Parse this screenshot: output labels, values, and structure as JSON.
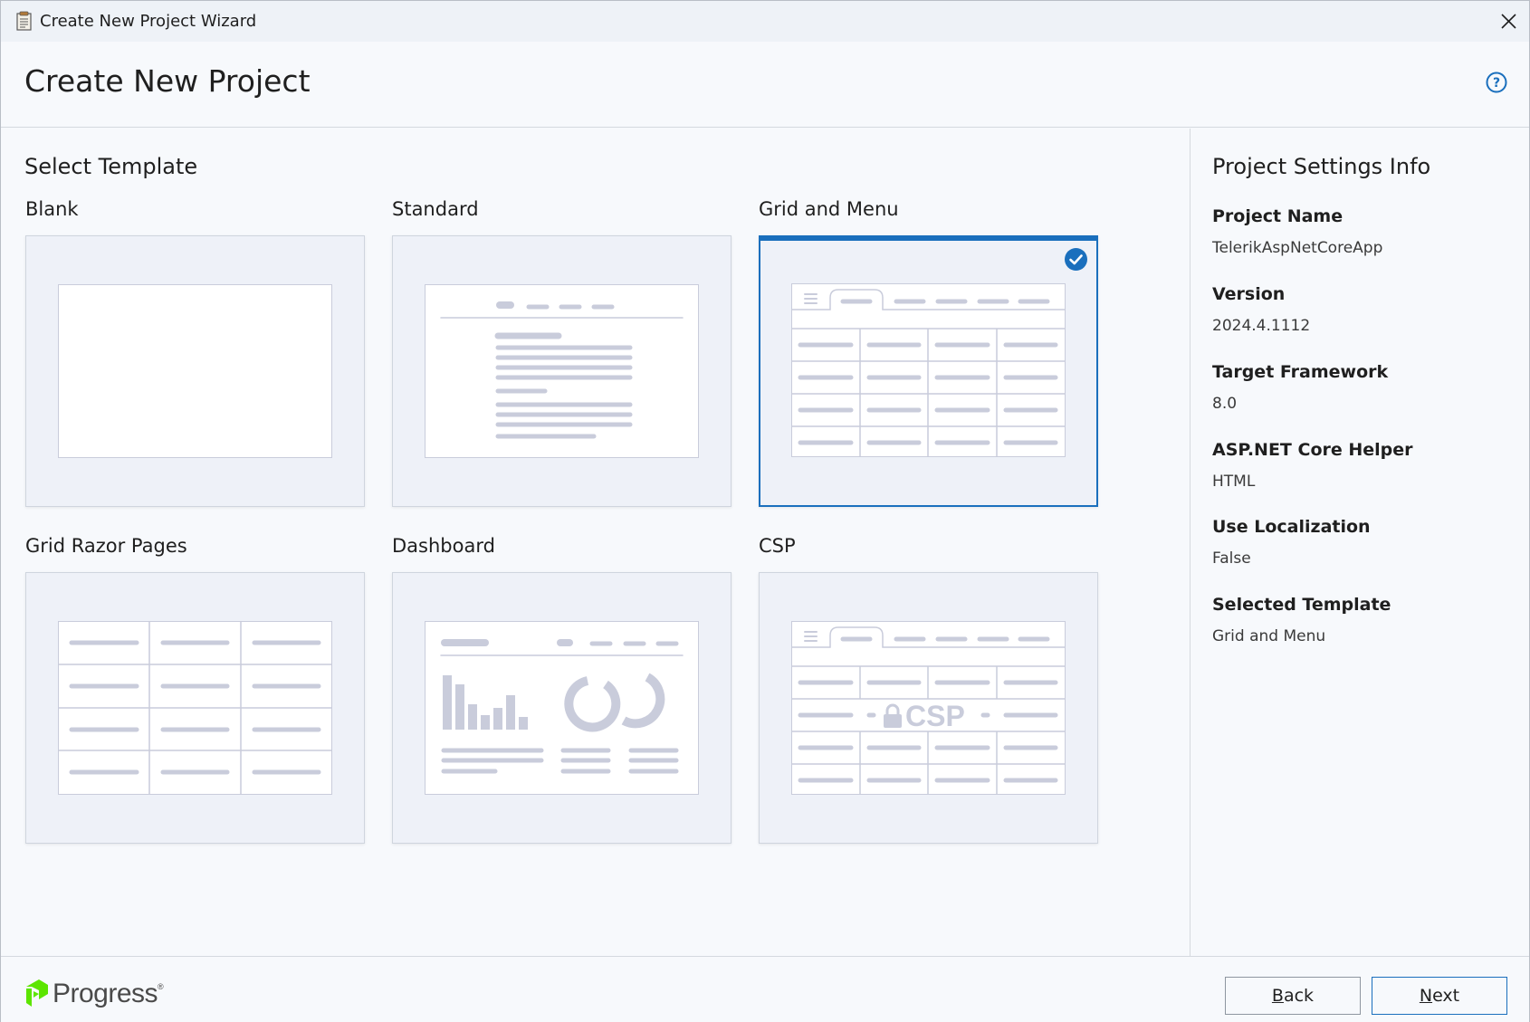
{
  "window": {
    "title": "Create New Project Wizard"
  },
  "header": {
    "title": "Create New Project"
  },
  "templates": {
    "section_title": "Select Template",
    "items": [
      {
        "label": "Blank"
      },
      {
        "label": "Standard"
      },
      {
        "label": "Grid and Menu",
        "selected": true
      },
      {
        "label": "Grid Razor Pages"
      },
      {
        "label": "Dashboard"
      },
      {
        "label": "CSP"
      }
    ],
    "csp_watermark": "CSP"
  },
  "settings": {
    "title": "Project Settings Info",
    "items": [
      {
        "label": "Project Name",
        "value": "TelerikAspNetCoreApp"
      },
      {
        "label": "Version",
        "value": "2024.4.1112"
      },
      {
        "label": "Target Framework",
        "value": "8.0"
      },
      {
        "label": "ASP.NET Core Helper",
        "value": "HTML"
      },
      {
        "label": "Use Localization",
        "value": "False"
      },
      {
        "label": "Selected Template",
        "value": "Grid and Menu"
      }
    ]
  },
  "footer": {
    "logo_text": "Progress",
    "back": {
      "prefix": "",
      "mnemonic": "B",
      "rest": "ack"
    },
    "next": {
      "prefix": "",
      "mnemonic": "N",
      "rest": "ext"
    }
  },
  "colors": {
    "accent": "#1a6fbd",
    "card_bg": "#eef1f8",
    "placeholder": "#c9ccdb",
    "logo_green": "#5ce500"
  },
  "icons": [
    "app-icon",
    "close-icon",
    "help-icon",
    "check-icon",
    "progress-logo-icon",
    "lock-icon"
  ]
}
